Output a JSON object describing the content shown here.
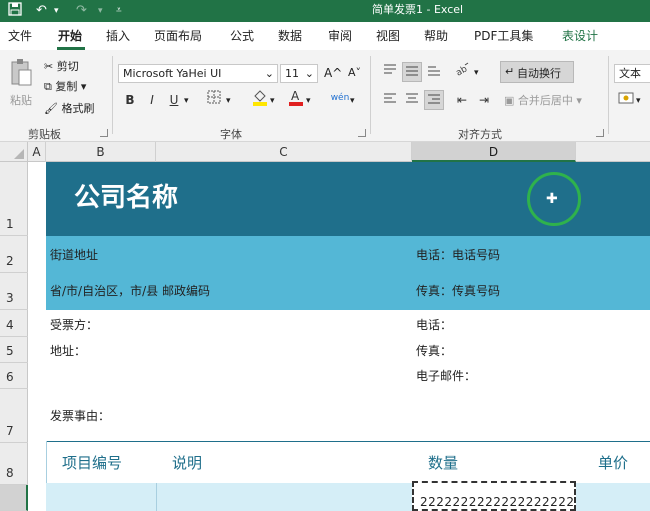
{
  "window": {
    "title": "简单发票1 - Excel"
  },
  "quick_access": {
    "save_icon": "save-icon",
    "undo_icon": "undo-icon",
    "redo_icon": "redo-icon",
    "customize_icon": "customize-qat-icon"
  },
  "tabs": [
    {
      "label": "文件"
    },
    {
      "label": "开始"
    },
    {
      "label": "插入"
    },
    {
      "label": "页面布局"
    },
    {
      "label": "公式"
    },
    {
      "label": "数据"
    },
    {
      "label": "审阅"
    },
    {
      "label": "视图"
    },
    {
      "label": "帮助"
    },
    {
      "label": "PDF工具集"
    },
    {
      "label": "表设计"
    }
  ],
  "ribbon": {
    "clipboard": {
      "paste": "粘贴",
      "cut": "剪切",
      "copy": "复制",
      "format_painter": "格式刷",
      "group_label": "剪贴板"
    },
    "font": {
      "font_name": "Microsoft YaHei UI",
      "font_size": "11",
      "grow": "A^",
      "shrink": "A˅",
      "bold": "B",
      "italic": "I",
      "underline": "U",
      "group_label": "字体"
    },
    "alignment": {
      "wrap_text": "自动换行",
      "merge_center": "合并后居中",
      "group_label": "对齐方式"
    },
    "number": {
      "format": "文本"
    }
  },
  "columns": [
    "A",
    "B",
    "C",
    "D"
  ],
  "rows": [
    "1",
    "2",
    "3",
    "4",
    "5",
    "6",
    "7",
    "8"
  ],
  "sheet": {
    "company_name": "公司名称",
    "street_address": "街道地址",
    "phone_line": "电话：电话号码",
    "region_line": "省/市/自治区，市/县 邮政编码",
    "fax_line": "传真：传真号码",
    "bill_to": "受票方：",
    "address": "地址：",
    "phone": "电话：",
    "fax": "传真：",
    "email": "电子邮件：",
    "invoice_reason": "发票事由：",
    "table_headers": {
      "item_no": "项目编号",
      "description": "说明",
      "quantity": "数量",
      "unit_price": "单价"
    },
    "selected_cell_value": "2222222222222222222"
  },
  "colors": {
    "excel_green": "#217346",
    "dark_band": "#1f6f8b",
    "light_band": "#54b7d6",
    "header_text": "#1f6f8b",
    "data_row": "#d5eef7"
  }
}
